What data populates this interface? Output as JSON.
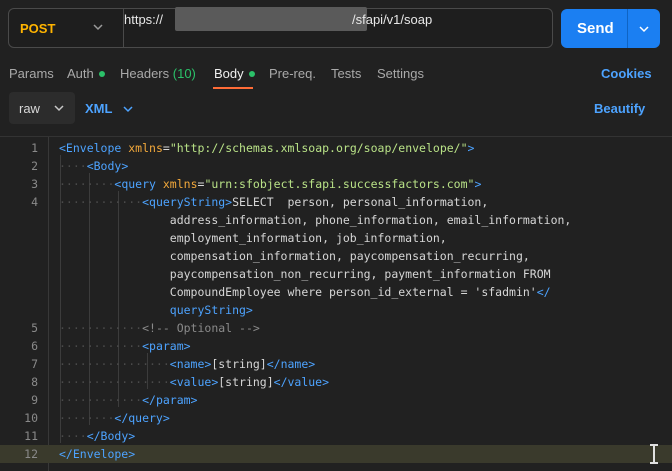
{
  "request": {
    "method": "POST",
    "url_prefix": "https://",
    "url_suffix": "/sfapi/v1/soap"
  },
  "send": {
    "label": "Send"
  },
  "tabs": [
    {
      "label": "Params"
    },
    {
      "label": "Auth"
    },
    {
      "label": "Headers",
      "count": "(10)"
    },
    {
      "label": "Body"
    },
    {
      "label": "Pre-req."
    },
    {
      "label": "Tests"
    },
    {
      "label": "Settings"
    }
  ],
  "cookies_label": "Cookies",
  "body_mode": {
    "selected": "raw",
    "language": "XML"
  },
  "beautify_label": "Beautify",
  "colors": {
    "accent": "#1b7ff2",
    "method": "#ffb400",
    "active_tab": "#ff6c37",
    "status_dot": "#2bc169"
  },
  "editor": {
    "line_numbers": [
      "1",
      "2",
      "3",
      "4",
      "",
      "",
      "",
      "",
      "",
      "",
      "",
      "5",
      "6",
      "7",
      "8",
      "9",
      "10",
      "11",
      "12"
    ]
  }
}
